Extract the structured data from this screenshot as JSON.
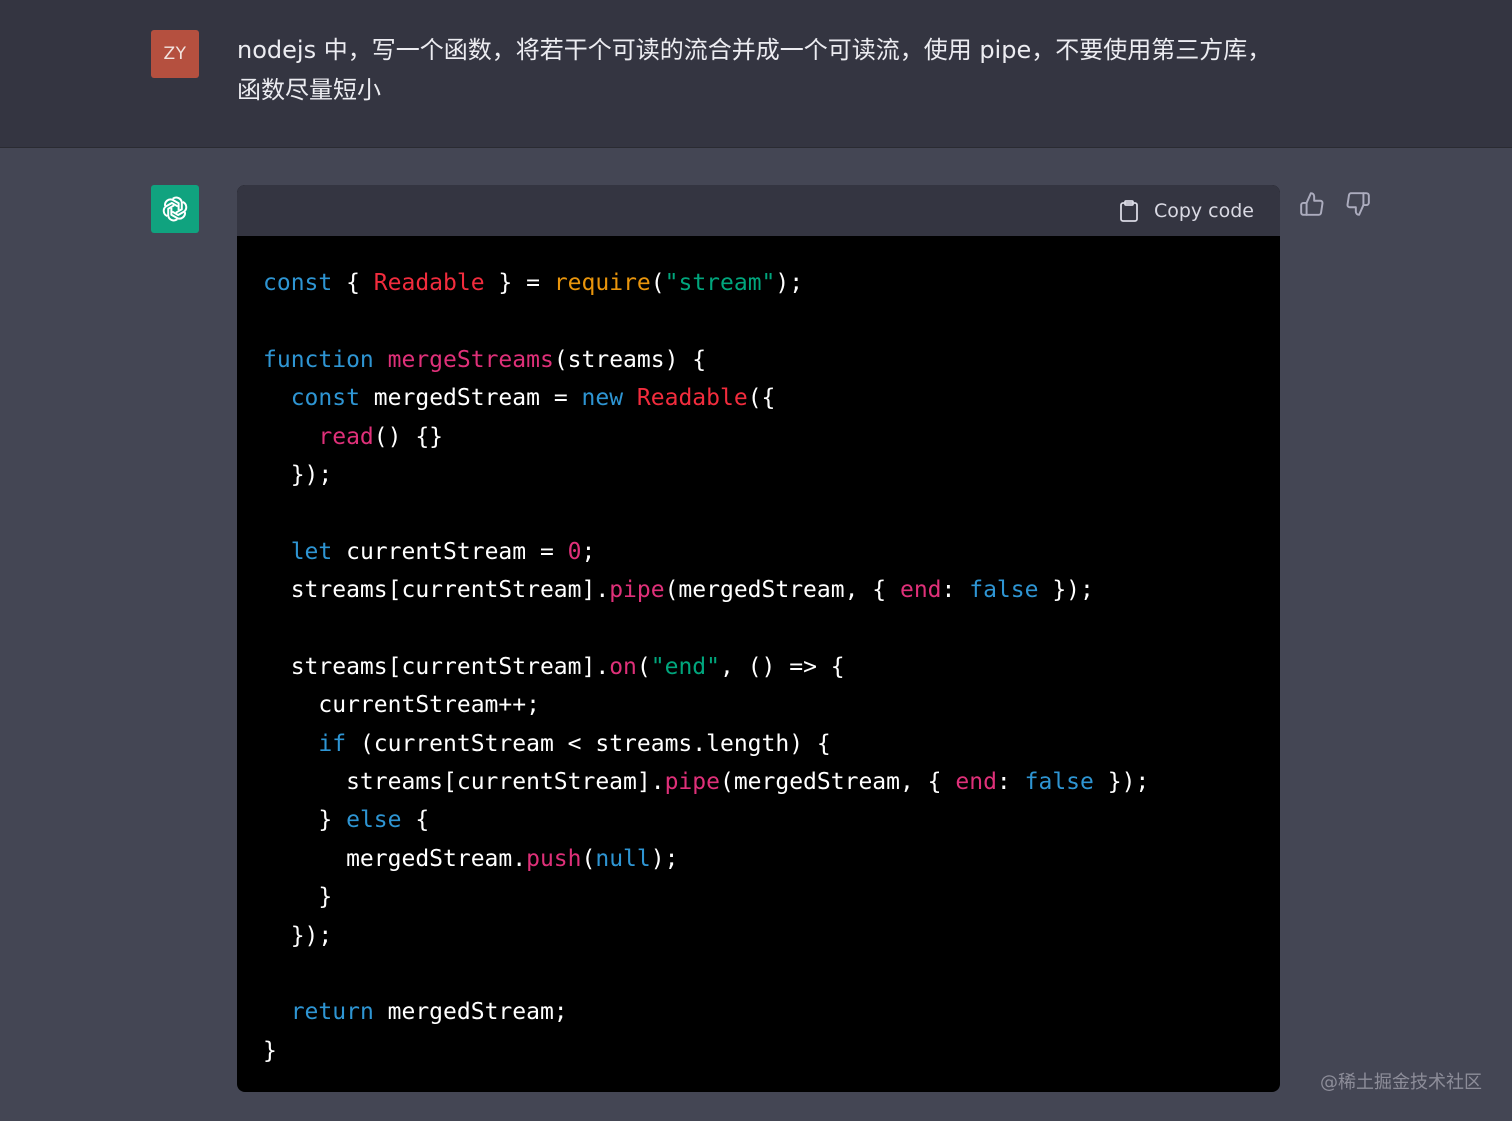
{
  "user_message": {
    "avatar_initials": "ZY",
    "text": "nodejs 中，写一个函数，将若干个可读的流合并成一个可读流，使用 pipe，不要使用第三方库，函数尽量短小"
  },
  "assistant": {
    "avatar_icon": "openai-logo-icon",
    "copy_label": "Copy code",
    "code_lines": [
      "const { Readable } = require(\"stream\");",
      "",
      "function mergeStreams(streams) {",
      "  const mergedStream = new Readable({",
      "    read() {}",
      "  });",
      "",
      "  let currentStream = 0;",
      "  streams[currentStream].pipe(mergedStream, { end: false });",
      "",
      "  streams[currentStream].on(\"end\", () => {",
      "    currentStream++;",
      "    if (currentStream < streams.length) {",
      "      streams[currentStream].pipe(mergedStream, { end: false });",
      "    } else {",
      "      mergedStream.push(null);",
      "    }",
      "  });",
      "",
      "  return mergedStream;",
      "}"
    ]
  },
  "feedback": {
    "thumbs_up_icon": "thumbs-up-icon",
    "thumbs_down_icon": "thumbs-down-icon"
  },
  "watermark": "@稀土掘金技术社区",
  "colors": {
    "user_band": "#343541",
    "assistant_band": "#444654",
    "code_bg": "#000000",
    "code_header": "#343541",
    "keyword": "#2e95d3",
    "class_name": "#f22c3d",
    "string": "#00a67d",
    "function": "#df3079",
    "user_avatar": "#b5503f",
    "bot_avatar": "#10a37f"
  }
}
